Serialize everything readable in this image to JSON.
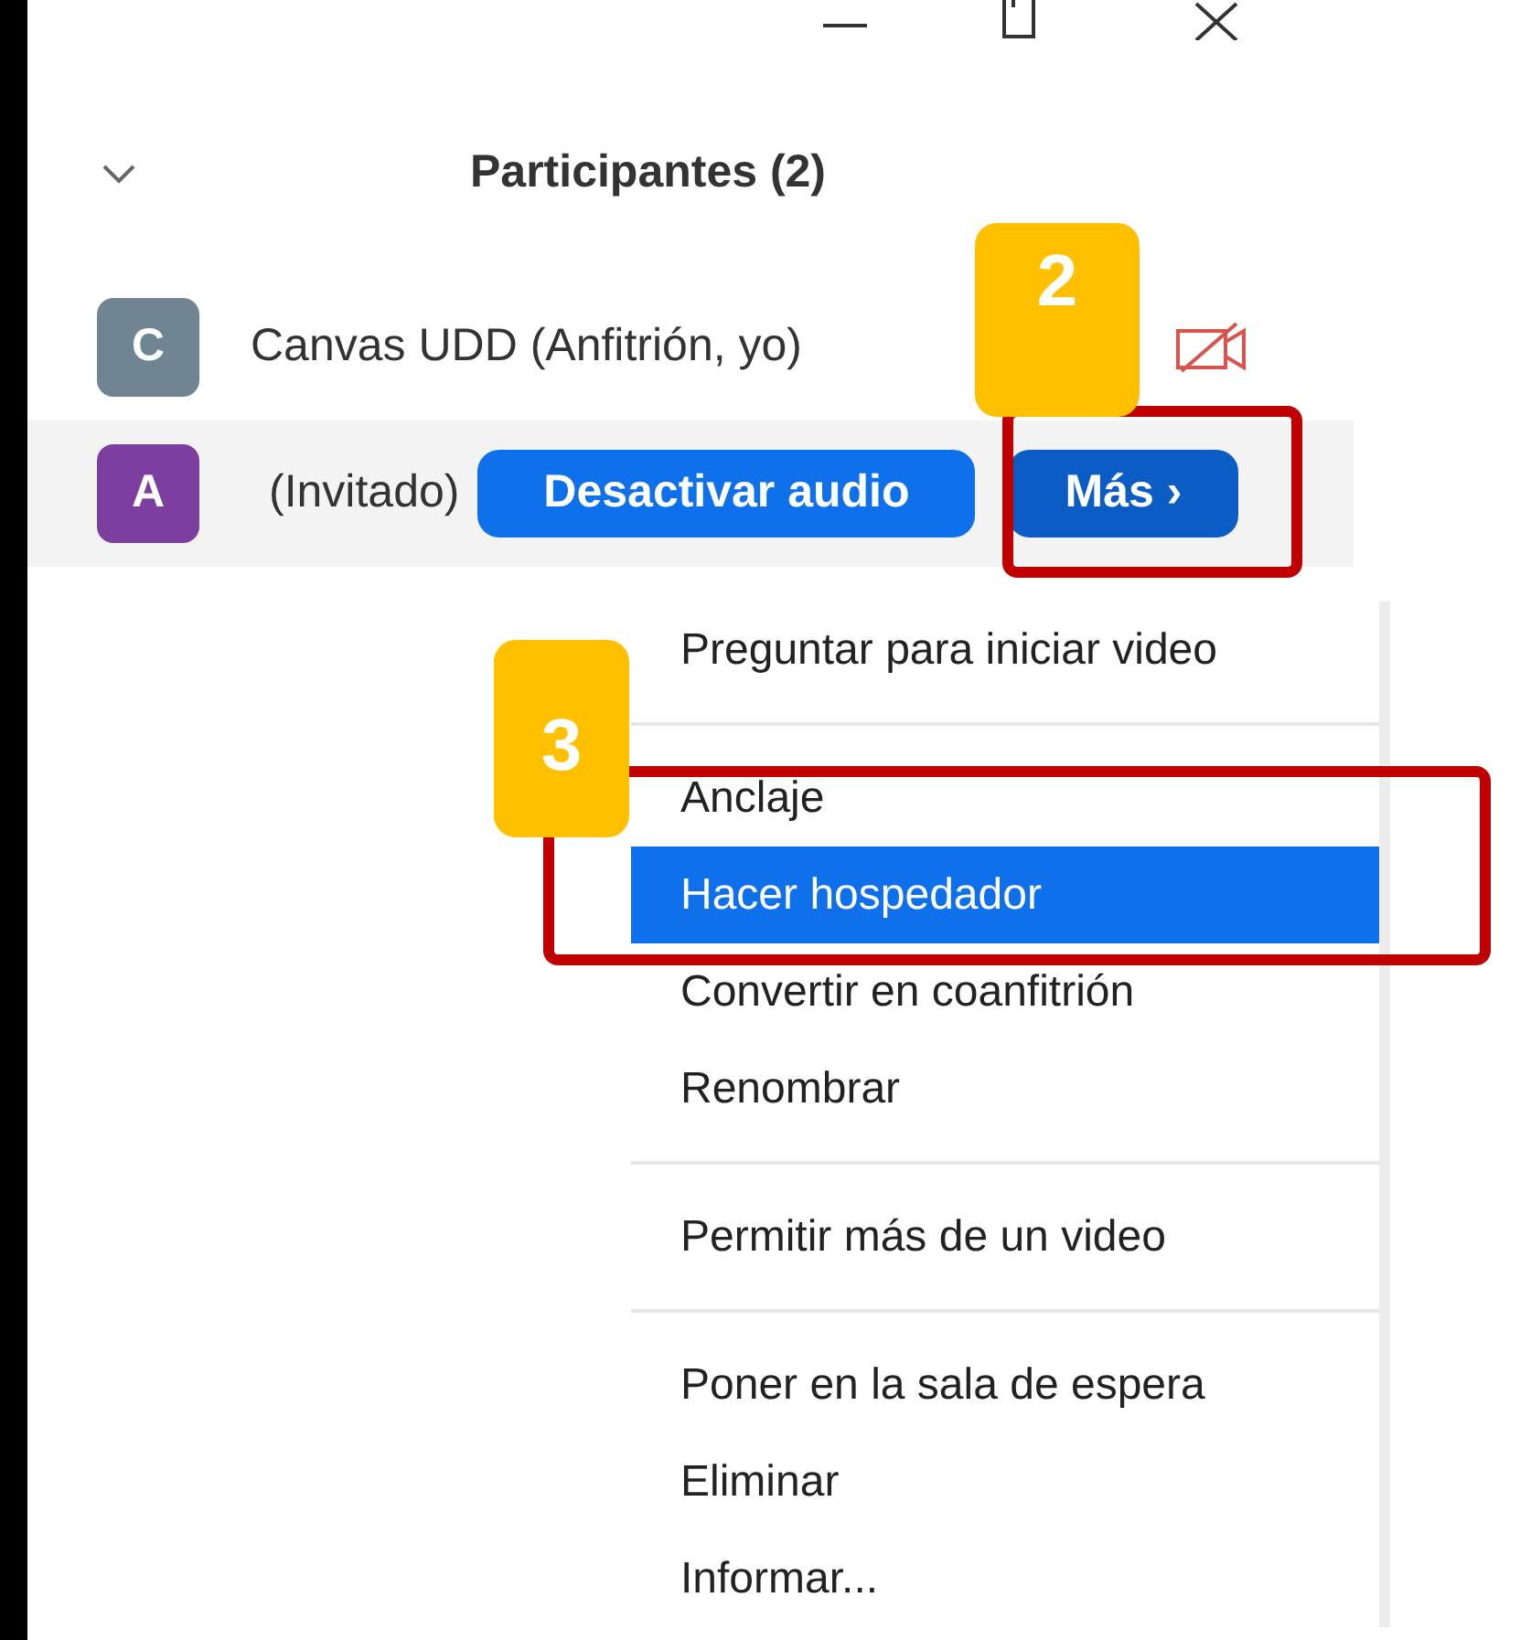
{
  "panel": {
    "title": "Participantes (2)"
  },
  "participants": [
    {
      "initial": "C",
      "color": "#6f8592",
      "name": "Canvas UDD (Anfitrión, yo)",
      "video_off": true
    },
    {
      "initial": "A",
      "color": "#7d3f9f",
      "name": "(Invitado)",
      "buttons": [
        {
          "label": "Desactivar audio",
          "kind": "action"
        },
        {
          "label": "Más ›",
          "kind": "more"
        }
      ]
    }
  ],
  "menu": {
    "groups": [
      [
        {
          "label": "Preguntar para iniciar video",
          "selected": false
        }
      ],
      [
        {
          "label": "Anclaje",
          "selected": false
        },
        {
          "label": "Hacer hospedador",
          "selected": true
        },
        {
          "label": "Convertir en coanfitrión",
          "selected": false
        },
        {
          "label": "Renombrar",
          "selected": false
        }
      ],
      [
        {
          "label": "Permitir más de un video",
          "selected": false
        }
      ],
      [
        {
          "label": "Poner en la sala de espera",
          "selected": false
        },
        {
          "label": "Eliminar",
          "selected": false
        },
        {
          "label": "Informar...",
          "selected": false
        }
      ]
    ]
  },
  "annotations": [
    {
      "label": "2"
    },
    {
      "label": "3"
    }
  ]
}
